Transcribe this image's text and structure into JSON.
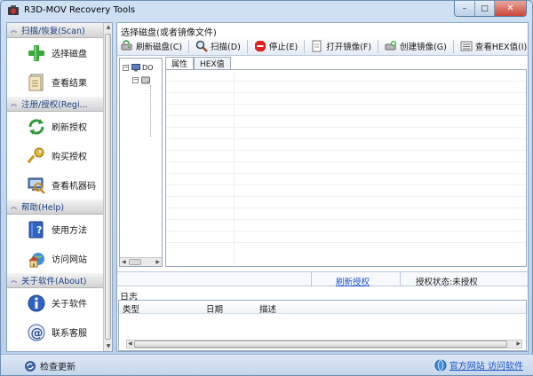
{
  "window": {
    "title": "R3D-MOV Recovery Tools",
    "controls": {
      "minimize": "–",
      "maximize": "□",
      "close": "✕"
    }
  },
  "sidebar": {
    "sections": [
      {
        "header": "扫描/恢复(Scan)",
        "items": [
          {
            "label": "选择磁盘",
            "icon": "green-plus-icon"
          },
          {
            "label": "查看结果",
            "icon": "document-list-icon"
          }
        ]
      },
      {
        "header": "注册/授权(Regi...",
        "items": [
          {
            "label": "刷新授权",
            "icon": "refresh-arrows-icon"
          },
          {
            "label": "购买授权",
            "icon": "key-icon"
          },
          {
            "label": "查看机器码",
            "icon": "computer-magnifier-icon"
          }
        ]
      },
      {
        "header": "帮助(Help)",
        "items": [
          {
            "label": "使用方法",
            "icon": "help-book-icon"
          },
          {
            "label": "访问网站",
            "icon": "home-globe-icon"
          }
        ]
      },
      {
        "header": "关于软件(About)",
        "items": [
          {
            "label": "关于软件",
            "icon": "info-icon"
          },
          {
            "label": "联系客服",
            "icon": "at-sign-icon"
          }
        ]
      }
    ]
  },
  "main": {
    "label": "选择磁盘(或者镜像文件)",
    "toolbar": [
      {
        "label": "刷新磁盘(C)",
        "icon": "refresh-disk-icon"
      },
      {
        "label": "扫描(D)",
        "icon": "magnifier-icon"
      },
      {
        "label": "停止(E)",
        "icon": "stop-icon"
      },
      {
        "label": "打开镜像(F)",
        "icon": "open-image-icon"
      },
      {
        "label": "创建镜像(G)",
        "icon": "create-image-icon"
      },
      {
        "label": "查看HEX值(I)",
        "icon": "hex-view-icon"
      }
    ],
    "tree": {
      "root": "DO"
    },
    "tabs": [
      "属性",
      "HEX值"
    ],
    "auth": {
      "link": "刷新授权",
      "status": "授权状态:未授权"
    },
    "log": {
      "title": "日志",
      "columns": [
        "类型",
        "日期",
        "描述"
      ]
    }
  },
  "status": {
    "left": "检查更新",
    "right": "官方网站 访问软件"
  },
  "colors": {
    "accent": "#1f56c9",
    "frame": "#bcd3ea"
  }
}
